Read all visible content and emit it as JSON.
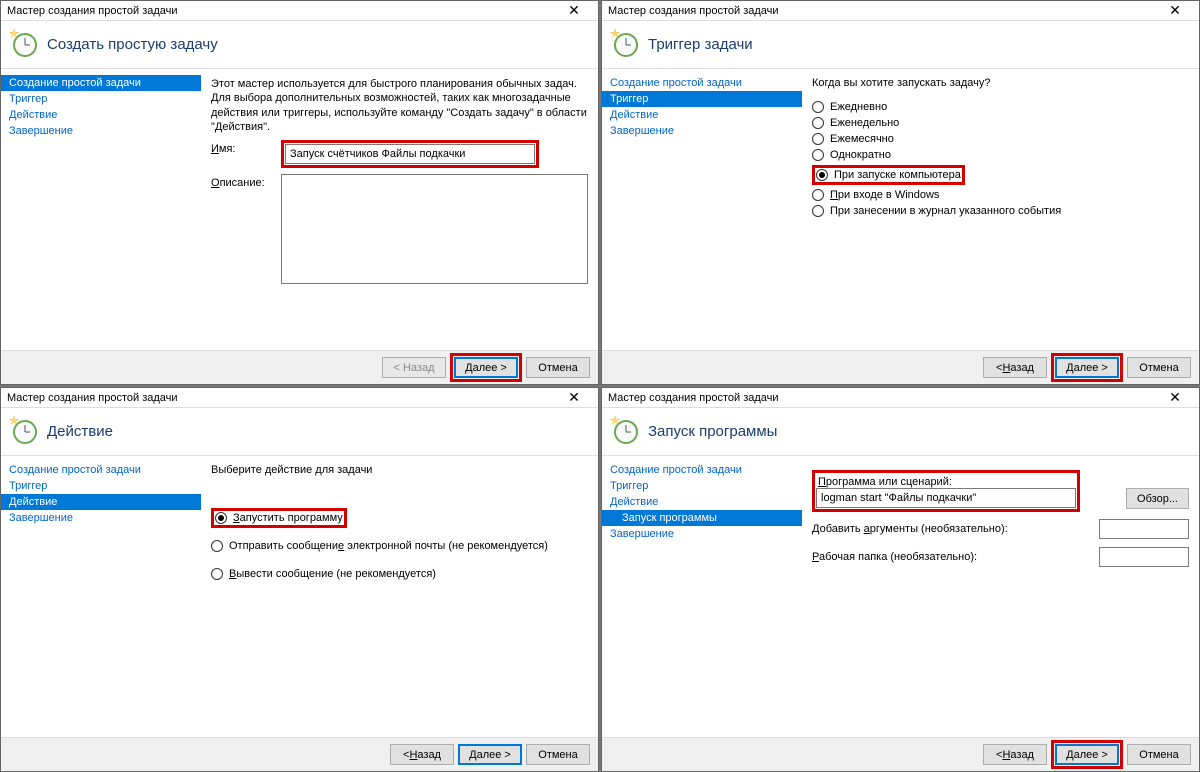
{
  "dialogTitle": "Мастер создания простой задачи",
  "btnBack": "< Назад",
  "btnNext": "Далее >",
  "btnCancel": "Отмена",
  "nav": {
    "create": "Создание простой задачи",
    "trigger": "Триггер",
    "action": "Действие",
    "finish": "Завершение",
    "runProgram": "Запуск программы"
  },
  "d1": {
    "heading": "Создать простую задачу",
    "intro": "Этот мастер используется для быстрого планирования обычных задач. Для выбора дополнительных возможностей, таких как многозадачные действия или триггеры, используйте команду \"Создать задачу\" в области \"Действия\".",
    "nameLabel": "Имя:",
    "nameValue": "Запуск счётчиков Файлы подкачки",
    "descLabel": "Описание:",
    "descValue": ""
  },
  "d2": {
    "heading": "Триггер задачи",
    "prompt": "Когда вы хотите запускать задачу?",
    "options": {
      "daily": "Ежедневно",
      "weekly": "Еженедельно",
      "monthly": "Ежемесячно",
      "once": "Однократно",
      "startup": "При запуске компьютера",
      "logon": "При входе в Windows",
      "event": "При занесении в журнал указанного события"
    }
  },
  "d3": {
    "heading": "Действие",
    "prompt": "Выберите действие для задачи",
    "options": {
      "run": "Запустить программу",
      "mail": "Отправить сообщение электронной почты (не рекомендуется)",
      "msg": "Вывести сообщение (не рекомендуется)"
    }
  },
  "d4": {
    "heading": "Запуск программы",
    "progLabel": "Программа или сценарий:",
    "progValue": "logman start \"Файлы подкачки\"",
    "browse": "Обзор...",
    "argsLabel": "Добавить аргументы (необязательно):",
    "argsValue": "",
    "cwdLabel": "Рабочая папка (необязательно):",
    "cwdValue": ""
  }
}
